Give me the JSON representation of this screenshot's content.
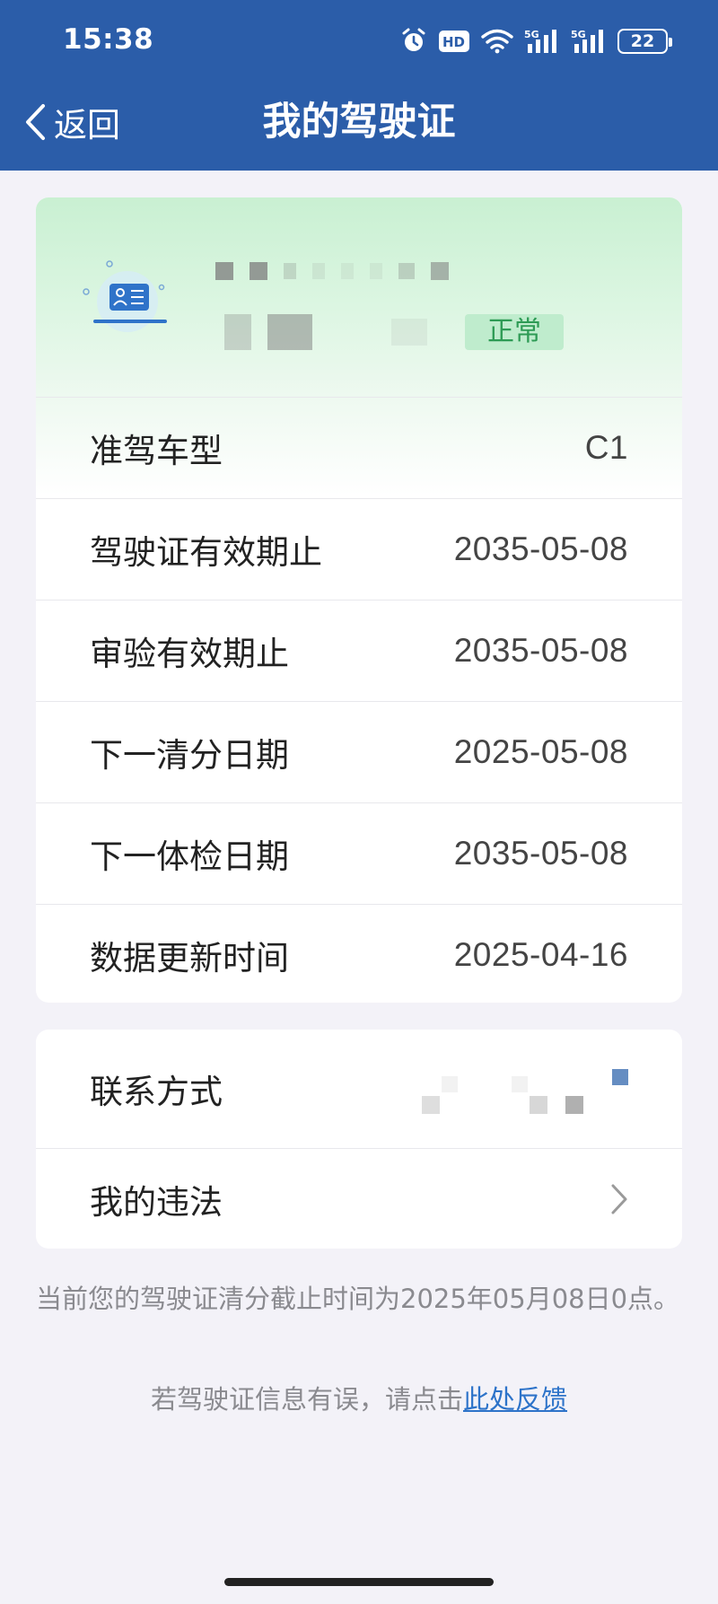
{
  "status_bar": {
    "time": "15:38",
    "battery": "22",
    "icons": [
      "alarm-icon",
      "hd-icon",
      "wifi-icon",
      "signal-5g-icon",
      "signal-5g-icon",
      "battery-icon"
    ]
  },
  "header": {
    "back_label": "返回",
    "title": "我的驾驶证"
  },
  "license": {
    "status": "正常",
    "rows": [
      {
        "label": "准驾车型",
        "value": "C1"
      },
      {
        "label": "驾驶证有效期止",
        "value": "2035-05-08"
      },
      {
        "label": "审验有效期止",
        "value": "2035-05-08"
      },
      {
        "label": "下一清分日期",
        "value": "2025-05-08"
      },
      {
        "label": "下一体检日期",
        "value": "2035-05-08"
      },
      {
        "label": "数据更新时间",
        "value": "2025-04-16"
      }
    ]
  },
  "contact": {
    "contact_label": "联系方式",
    "violations_label": "我的违法"
  },
  "footer": {
    "note": "当前您的驾驶证清分截止时间为2025年05月08日0点。",
    "feedback_prefix": "若驾驶证信息有误，请点击",
    "feedback_link": "此处反馈"
  },
  "colors": {
    "header_bg": "#2b5da9",
    "page_bg": "#f3f2f8",
    "status_green": "#2e9b55",
    "link_blue": "#2d73c9"
  }
}
